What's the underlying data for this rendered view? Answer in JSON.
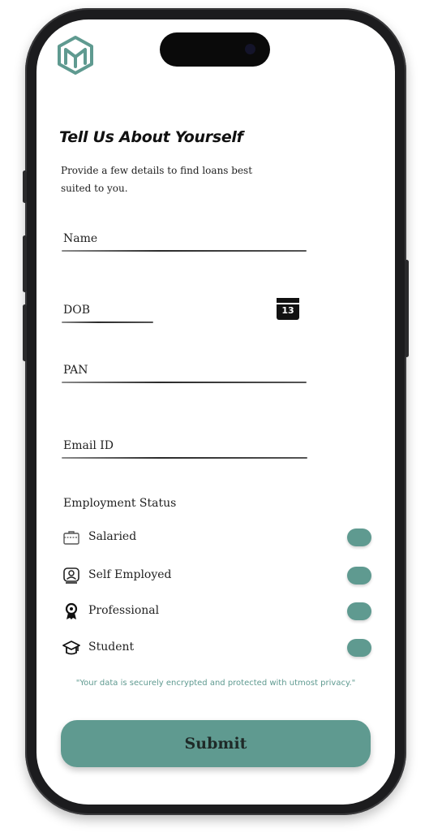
{
  "header": {
    "logo_icon": "m-cube-logo-icon"
  },
  "form": {
    "title": "Tell Us About Yourself",
    "subtitle": "Provide a few details to find loans best suited to you.",
    "fields": {
      "name_label": "Name",
      "dob_label": "DOB",
      "dob_icon": "calendar-icon",
      "dob_icon_text": "13",
      "pan_label": "PAN",
      "email_label": "Email ID"
    },
    "employment": {
      "label": "Employment Status",
      "options": [
        {
          "label": "Salaried",
          "icon": "briefcase-icon"
        },
        {
          "label": "Self Employed",
          "icon": "user-badge-icon"
        },
        {
          "label": "Professional",
          "icon": "award-ribbon-icon"
        },
        {
          "label": "Student",
          "icon": "graduation-cap-icon"
        }
      ]
    },
    "privacy_note": "\"Your data is securely encrypted and protected with utmost privacy.\"",
    "submit_label": "Submit"
  },
  "colors": {
    "accent": "#5f9a90",
    "text": "#222222",
    "background": "#ffffff",
    "frame": "#1c1c1e"
  }
}
